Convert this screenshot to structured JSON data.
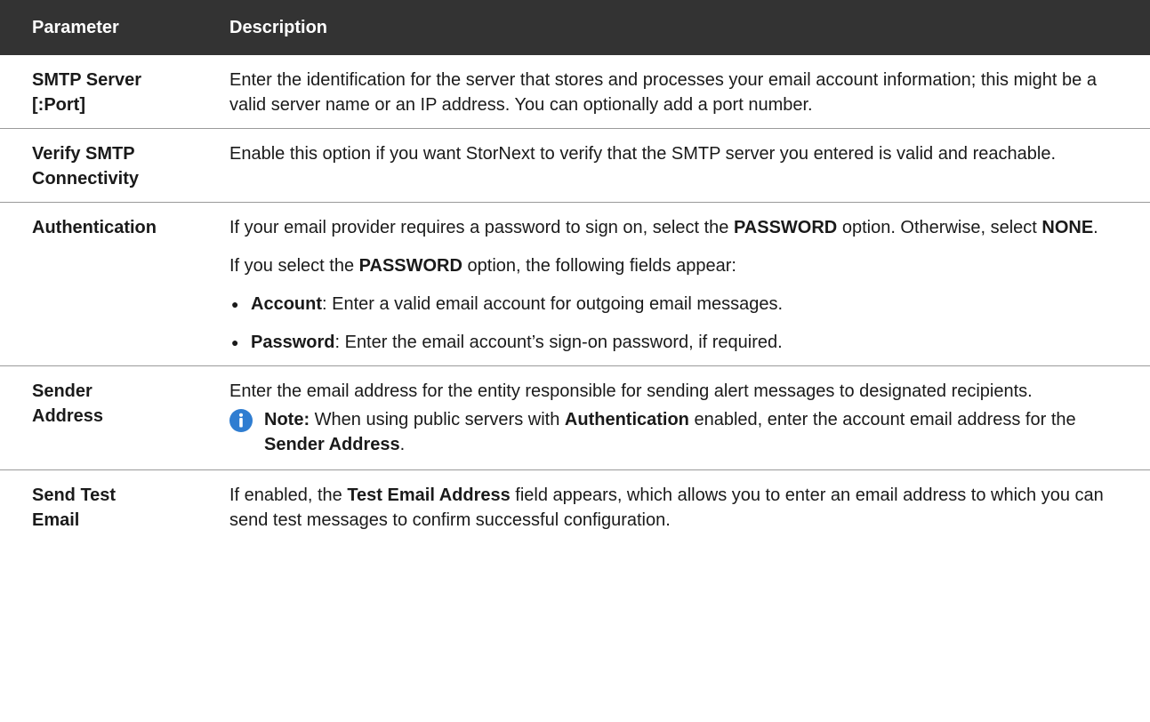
{
  "table": {
    "headers": {
      "parameter": "Parameter",
      "description": "Description"
    },
    "rows": [
      {
        "param_line1": "SMTP Server",
        "param_line2": "[:Port]",
        "desc": "Enter the identification for the server that stores and processes your email account information; this might be a valid server name or an IP address. You can optionally add a port number."
      },
      {
        "param_line1": "Verify SMTP",
        "param_line2": "Connectivity",
        "desc": "Enable this option if you want StorNext to verify that the SMTP server you entered is valid and reachable."
      },
      {
        "param_line1": "Authentication",
        "p1_a": "If your email provider requires a password to sign on, select the ",
        "p1_b": "PASSWORD",
        "p1_c": " option. Otherwise, select ",
        "p1_d": "NONE",
        "p1_e": ".",
        "p2_a": "If you select the ",
        "p2_b": "PASSWORD",
        "p2_c": " option, the following fields appear:",
        "bullets": [
          {
            "term": "Account",
            "text": ": Enter a valid email account for outgoing email messages."
          },
          {
            "term": "Password",
            "text": ": Enter the email account’s sign-on password, if required."
          }
        ]
      },
      {
        "param_line1": "Sender",
        "param_line2": "Address",
        "desc": "Enter the email address for the entity responsible for sending alert messages to designated recipients.",
        "note": {
          "icon": "info-icon",
          "icon_color": "#2f7dd1",
          "label": "Note:",
          "t1": " When using public servers with ",
          "t2": "Authentication",
          "t3": " enabled, enter the account email address for the ",
          "t4": "Sender Address",
          "t5": "."
        }
      },
      {
        "param_line1": "Send Test",
        "param_line2": "Email",
        "d1": "If enabled, the ",
        "d2": "Test Email Address",
        "d3": " field appears, which allows you to enter an email address to which you can send test messages to confirm successful configuration."
      }
    ]
  },
  "colors": {
    "header_bg": "#333333",
    "header_text": "#ffffff",
    "row_divider": "#9a9a9a"
  }
}
